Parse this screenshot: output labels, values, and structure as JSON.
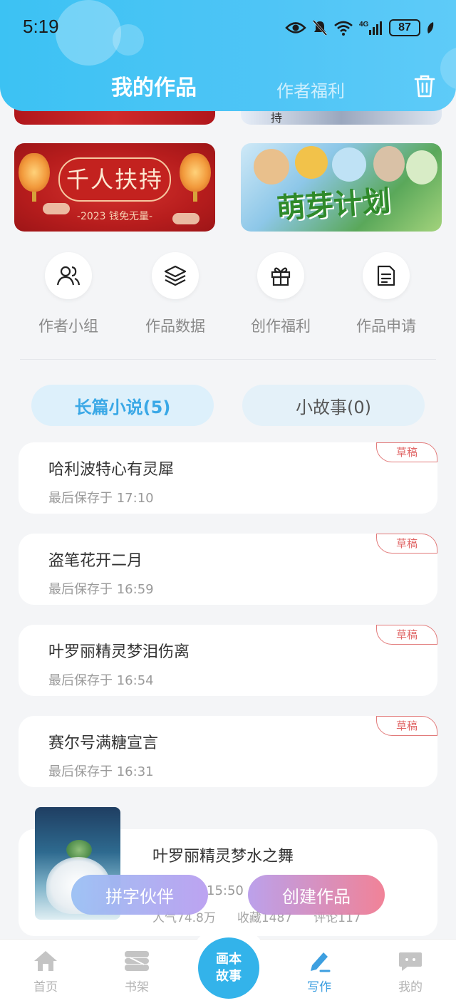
{
  "status_bar": {
    "time": "5:19",
    "battery": "87",
    "network": "4G"
  },
  "header": {
    "tab_works": "我的作品",
    "tab_welfare": "作者福利"
  },
  "banners": {
    "red": {
      "title": "千人扶持",
      "subtitle": "-2023 钱免无量-"
    },
    "green": {
      "title": "萌芽计划"
    },
    "top_strip_right_text": "持"
  },
  "actions": [
    {
      "label": "作者小组",
      "icon": "people-icon"
    },
    {
      "label": "作品数据",
      "icon": "layers-icon"
    },
    {
      "label": "创作福利",
      "icon": "gift-icon"
    },
    {
      "label": "作品申请",
      "icon": "document-icon"
    }
  ],
  "segments": {
    "long": "长篇小说(5)",
    "short": "小故事(0)"
  },
  "drafts": [
    {
      "title": "哈利波特心有灵犀",
      "time": "最后保存于 17:10",
      "tag": "草稿"
    },
    {
      "title": "盗笔花开二月",
      "time": "最后保存于 16:59",
      "tag": "草稿"
    },
    {
      "title": "叶罗丽精灵梦泪伤离",
      "time": "最后保存于 16:54",
      "tag": "草稿"
    },
    {
      "title": "赛尔号满糖宣言",
      "time": "最后保存于 16:31",
      "tag": "草稿"
    }
  ],
  "published": {
    "title": "叶罗丽精灵梦水之舞",
    "time_partial": "15:50",
    "stats": [
      "人气74.8万",
      "收藏1487",
      "评论117"
    ]
  },
  "buttons": {
    "partner": "拼字伙伴",
    "create": "创建作品"
  },
  "nav": {
    "home": "首页",
    "bookshelf": "书架",
    "center_line1": "画本",
    "center_line2": "故事",
    "write": "写作",
    "mine": "我的"
  },
  "colors": {
    "accent": "#3cc2f3",
    "draft_tag": "#e06666",
    "active_nav": "#3d9fe0"
  }
}
